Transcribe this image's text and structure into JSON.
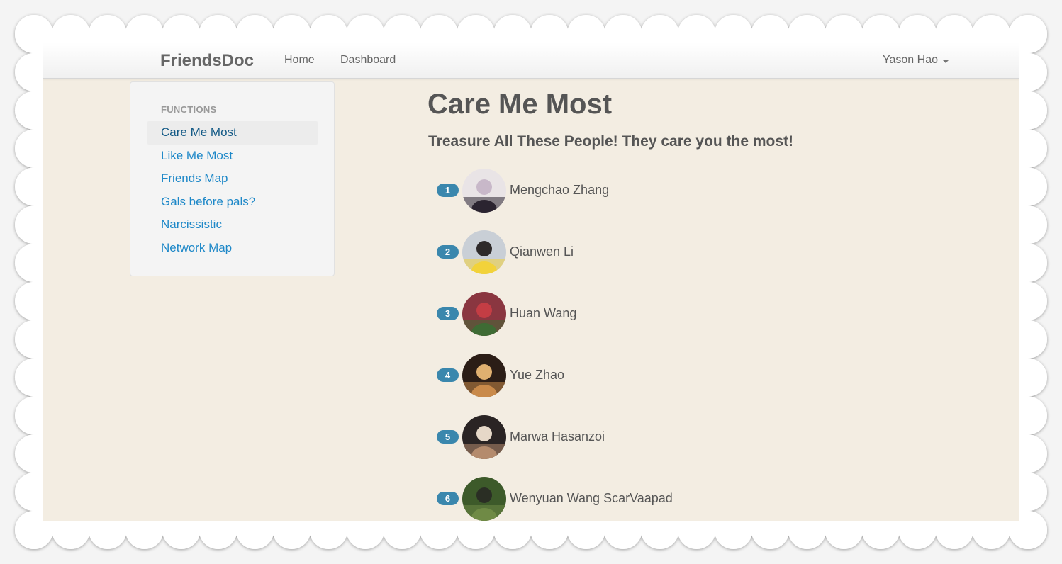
{
  "navbar": {
    "brand": "FriendsDoc",
    "home": "Home",
    "dashboard": "Dashboard",
    "user": "Yason Hao"
  },
  "sidebar": {
    "header": "FUNCTIONS",
    "items": [
      {
        "label": "Care Me Most",
        "active": true
      },
      {
        "label": "Like Me Most",
        "active": false
      },
      {
        "label": "Friends Map",
        "active": false
      },
      {
        "label": "Gals before pals?",
        "active": false
      },
      {
        "label": "Narcissistic",
        "active": false
      },
      {
        "label": "Network Map",
        "active": false
      }
    ]
  },
  "main": {
    "title": "Care Me Most",
    "subtitle": "Treasure All These People! They care you the most!",
    "friends": [
      {
        "rank": "1",
        "name": "Mengchao Zhang",
        "avatar_colors": [
          "#e9e4e6",
          "#2b2430",
          "#c8b8c9"
        ]
      },
      {
        "rank": "2",
        "name": "Qianwen Li",
        "avatar_colors": [
          "#c9cfd6",
          "#f2d23a",
          "#2e2a2a"
        ]
      },
      {
        "rank": "3",
        "name": "Huan Wang",
        "avatar_colors": [
          "#8a3640",
          "#3e6b34",
          "#c43d44"
        ]
      },
      {
        "rank": "4",
        "name": "Yue Zhao",
        "avatar_colors": [
          "#2b1d16",
          "#c98a4a",
          "#e0b070"
        ]
      },
      {
        "rank": "5",
        "name": "Marwa Hasanzoi",
        "avatar_colors": [
          "#2a2424",
          "#b48b6d",
          "#e6d8c8"
        ]
      },
      {
        "rank": "6",
        "name": "Wenyuan Wang ScarVaapad",
        "avatar_colors": [
          "#3d5a2a",
          "#6f8a45",
          "#2a2e24"
        ]
      }
    ]
  },
  "colors": {
    "background": "#f3ede2",
    "link": "#1e88c8",
    "badge": "#3a87ad"
  }
}
